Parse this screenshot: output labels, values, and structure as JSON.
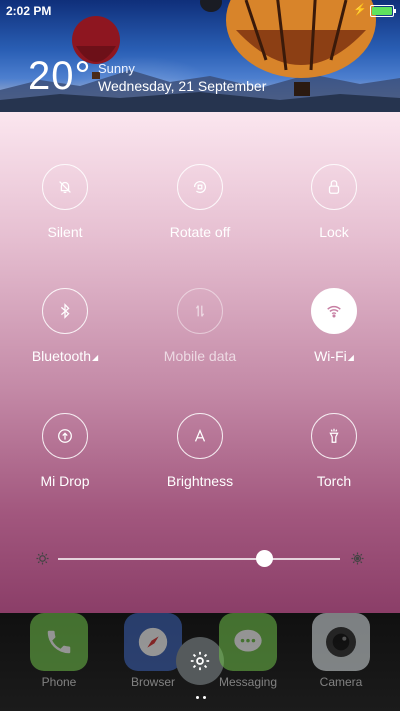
{
  "status_bar": {
    "time": "2:02 PM",
    "battery_level": 1.0,
    "charging": true
  },
  "weather": {
    "temperature": "20°",
    "condition": "Sunny",
    "date": "Wednesday, 21 September"
  },
  "toggles": [
    {
      "label": "Silent",
      "icon": "bell-off-icon",
      "state": "off"
    },
    {
      "label": "Rotate off",
      "icon": "rotate-lock-icon",
      "state": "off"
    },
    {
      "label": "Lock",
      "icon": "lock-icon",
      "state": "off"
    },
    {
      "label": "Bluetooth",
      "icon": "bluetooth-icon",
      "state": "off",
      "has_menu": true
    },
    {
      "label": "Mobile data",
      "icon": "mobile-data-icon",
      "state": "disabled"
    },
    {
      "label": "Wi-Fi",
      "icon": "wifi-icon",
      "state": "on",
      "has_menu": true
    },
    {
      "label": "Mi Drop",
      "icon": "mi-drop-icon",
      "state": "off"
    },
    {
      "label": "Brightness",
      "icon": "auto-brightness-icon",
      "state": "off"
    },
    {
      "label": "Torch",
      "icon": "torch-icon",
      "state": "off"
    }
  ],
  "brightness": {
    "level": 0.73
  },
  "dock": {
    "apps": [
      {
        "label": "Phone",
        "icon": "phone-icon",
        "color": "#6fc04a"
      },
      {
        "label": "Browser",
        "icon": "compass-icon",
        "color": "#3d63b8"
      },
      {
        "label": "Messaging",
        "icon": "message-icon",
        "color": "#6fc04a"
      },
      {
        "label": "Camera",
        "icon": "camera-icon",
        "color": "#d6dde0"
      }
    ],
    "settings_icon": "gear-icon"
  },
  "colors": {
    "active_toggle": "#ffffff",
    "panel_top": "#fbe6ef",
    "panel_bottom": "#8b3e68"
  }
}
